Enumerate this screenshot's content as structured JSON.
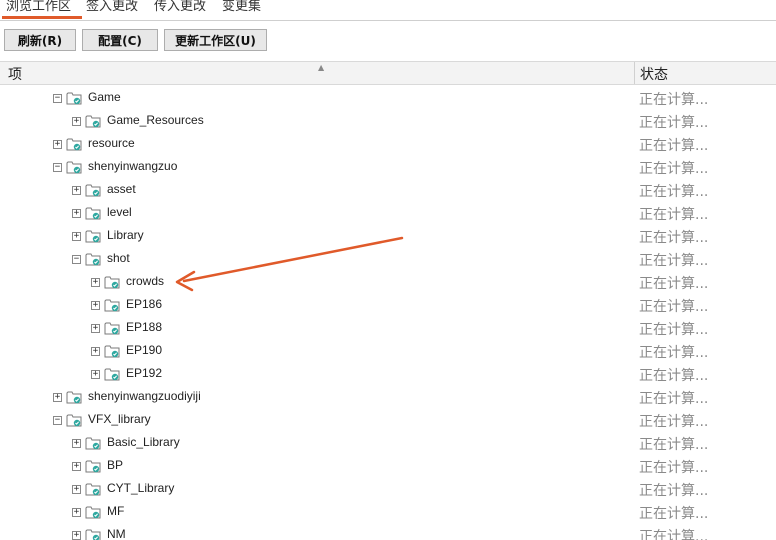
{
  "tabs": [
    {
      "label": "浏览工作区",
      "active": true
    },
    {
      "label": "签入更改"
    },
    {
      "label": "传入更改"
    },
    {
      "label": "变更集"
    }
  ],
  "toolbar": {
    "refresh_label": "刷新(R)",
    "config_label": "配置(C)",
    "update_label": "更新工作区(U)"
  },
  "columns": {
    "item": "项",
    "status": "状态"
  },
  "tree": [
    {
      "label": "Game",
      "expanded": true
    },
    {
      "label": "Game_Resources",
      "expanded": false
    },
    {
      "label": "resource",
      "expanded": false
    },
    {
      "label": "shenyinwangzuo",
      "expanded": true
    },
    {
      "label": "asset",
      "expanded": false
    },
    {
      "label": "level",
      "expanded": false
    },
    {
      "label": "Library",
      "expanded": false
    },
    {
      "label": "shot",
      "expanded": true
    },
    {
      "label": "crowds",
      "expanded": false
    },
    {
      "label": "EP186",
      "expanded": false
    },
    {
      "label": "EP188",
      "expanded": false
    },
    {
      "label": "EP190",
      "expanded": false
    },
    {
      "label": "EP192",
      "expanded": false
    },
    {
      "label": "shenyinwangzuodiyiji",
      "expanded": false
    },
    {
      "label": "VFX_library",
      "expanded": true
    },
    {
      "label": "Basic_Library",
      "expanded": false
    },
    {
      "label": "BP",
      "expanded": false
    },
    {
      "label": "CYT_Library",
      "expanded": false
    },
    {
      "label": "MF",
      "expanded": false
    },
    {
      "label": "NM",
      "expanded": false
    }
  ],
  "status_text": "正在计算...",
  "colors": {
    "accent": "#e05a2a",
    "folder_stroke": "#7a7a7a",
    "check": "#2ea8a0"
  }
}
